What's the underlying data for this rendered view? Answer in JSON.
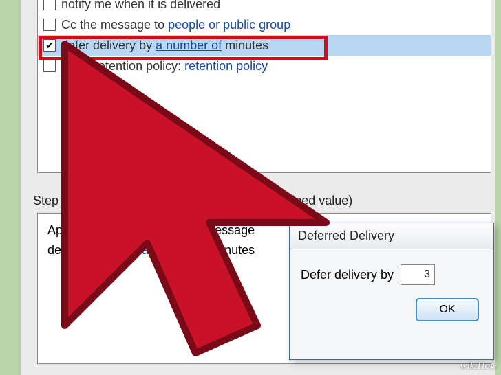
{
  "options": {
    "notify": {
      "checked": false,
      "label": "notify me when it is delivered"
    },
    "cc": {
      "checked": false,
      "label_prefix": "Cc the message to ",
      "label_link": "people or public group"
    },
    "defer": {
      "checked": true,
      "label_prefix": "defer delivery by ",
      "link": "a number of",
      "label_suffix": " minutes"
    },
    "retention": {
      "checked": false,
      "label_prefix": "apply retention policy: ",
      "link": "retention policy"
    }
  },
  "step2_label": "Step 2: Edit the rule description (click an underlined value)",
  "description": {
    "line1": "Apply this rule after I send a message",
    "line2_prefix": "defer delivery by ",
    "line2_link": "a number of",
    "line2_suffix": " minutes"
  },
  "dialog": {
    "title": "Deferred Delivery",
    "label": "Defer delivery by",
    "value": "3",
    "ok": "OK"
  },
  "watermark": "wikiHow"
}
